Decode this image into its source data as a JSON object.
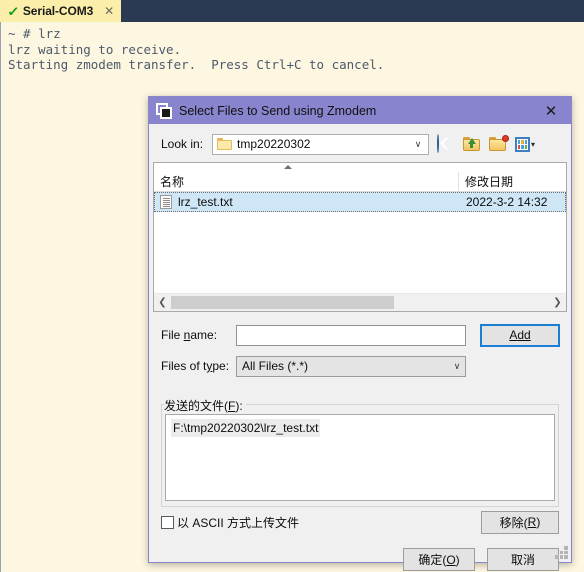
{
  "terminal": {
    "tab": {
      "label": "Serial-COM3",
      "status_icon": "check-icon",
      "close_icon": "close-icon"
    },
    "lines": [
      "~ # lrz",
      "lrz waiting to receive.",
      "Starting zmodem transfer.  Press Ctrl+C to cancel."
    ],
    "colors": {
      "tab_background": "#fbeeab",
      "header_background": "#2b3a52",
      "terminal_background": "#fdf6e0",
      "terminal_text": "#4c5a6b",
      "check_green": "#18a018"
    }
  },
  "dialog": {
    "title": "Select Files to Send using Zmodem",
    "title_icon": "window-icon",
    "close_label": "✕",
    "titlebar_color": "#8984ce",
    "lookin": {
      "label": "Look in:",
      "value": "tmp20220302",
      "folder_icon": "folder-icon",
      "caret": "∨",
      "tools": [
        {
          "name": "back-icon",
          "title": "Back"
        },
        {
          "name": "up-one-level-icon",
          "title": "Up One Level"
        },
        {
          "name": "new-folder-icon",
          "title": "Create New Folder"
        },
        {
          "name": "views-icon",
          "title": "Views"
        }
      ],
      "views_caret": "▾"
    },
    "filelist": {
      "columns": [
        "名称",
        "修改日期"
      ],
      "sort_indicator": "ascending",
      "rows": [
        {
          "icon": "text-file-icon",
          "name": "lrz_test.txt",
          "modified": "2022-3-2 14:32",
          "selected": true
        }
      ],
      "scroll": {
        "left_arrow": "❮",
        "right_arrow": "❯"
      }
    },
    "filename": {
      "label_prefix": "File ",
      "label_accel": "n",
      "label_suffix": "ame:",
      "value": "",
      "placeholder": ""
    },
    "add_button": {
      "text_prefix": "",
      "accel": "A",
      "text_suffix": "dd"
    },
    "filetype": {
      "label_prefix": "Files of t",
      "label_accel": "y",
      "label_suffix": "pe:",
      "value": "All Files (*.*)",
      "caret": "∨"
    },
    "sendfiles": {
      "legend_prefix": "发送的文件(",
      "legend_accel": "F",
      "legend_suffix": "):",
      "items": [
        "F:\\tmp20220302\\lrz_test.txt"
      ]
    },
    "ascii_checkbox": {
      "checked": false,
      "label": "以 ASCII 方式上传文件"
    },
    "remove_button": {
      "text_prefix": "移除(",
      "accel": "R",
      "text_suffix": ")"
    },
    "buttons": [
      {
        "name": "ok-button",
        "prefix": "确定(",
        "accel": "O",
        "suffix": ")"
      },
      {
        "name": "cancel-button",
        "prefix": "取消",
        "accel": "",
        "suffix": ""
      }
    ],
    "resize_grip": "resize-grip-icon"
  }
}
